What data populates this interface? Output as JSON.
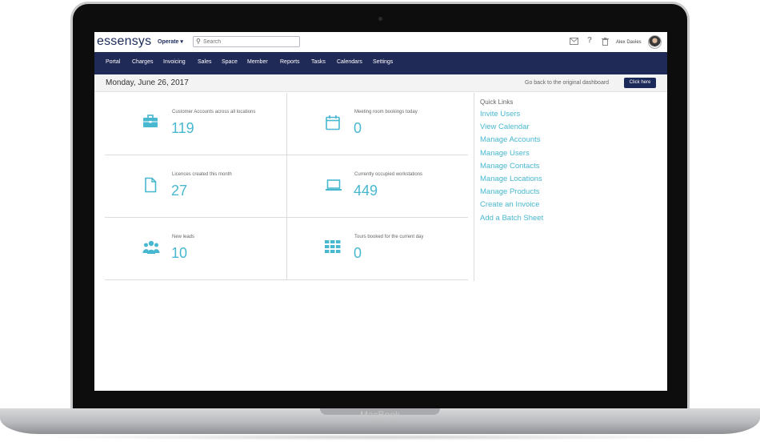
{
  "device_label": "MacBook",
  "header": {
    "logo": "essensys",
    "workspace": "Operate",
    "workspace_caret": "▾",
    "search_placeholder": "Search",
    "user_name": "Alex Davies"
  },
  "nav": [
    "Portal",
    "Charges",
    "Invoicing",
    "Sales",
    "Space",
    "Member",
    "Reports",
    "Tasks",
    "Calendars",
    "Settings"
  ],
  "date_bar": {
    "date": "Monday, June 26, 2017",
    "go_back_text": "Go back to the original dashboard",
    "button_label": "Click here"
  },
  "stats": [
    {
      "icon": "briefcase-icon",
      "label": "Customer Accounts across all locations",
      "value": "119"
    },
    {
      "icon": "calendar-icon",
      "label": "Meeting room bookings today",
      "value": "0"
    },
    {
      "icon": "document-icon",
      "label": "Licences created this month",
      "value": "27"
    },
    {
      "icon": "laptop-icon",
      "label": "Currently occupied workstations",
      "value": "449"
    },
    {
      "icon": "users-icon",
      "label": "New leads",
      "value": "10"
    },
    {
      "icon": "grid-icon",
      "label": "Tours booked for the current day",
      "value": "0"
    }
  ],
  "quick_links": {
    "title": "Quick Links",
    "items": [
      "Invite Users",
      "View Calendar",
      "Manage Accounts",
      "Manage Users",
      "Manage Contacts",
      "Manage Locations",
      "Manage Products",
      "Create an Invoice",
      "Add a Batch Sheet"
    ]
  },
  "colors": {
    "nav_bg": "#1f2a57",
    "accent": "#48b8d0",
    "brand": "#1c2a5a"
  }
}
